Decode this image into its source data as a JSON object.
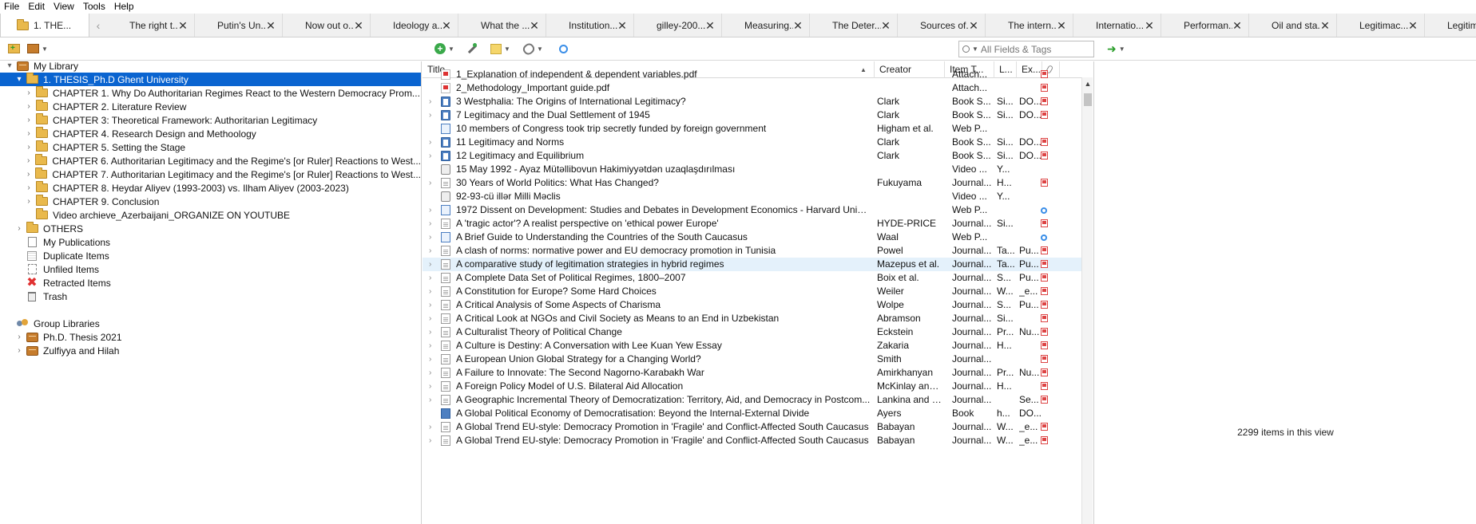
{
  "menubar": [
    "File",
    "Edit",
    "View",
    "Tools",
    "Help"
  ],
  "tabs": {
    "active": "1. THE...",
    "others": [
      "The right t...",
      "Putin's Un...",
      "Now out o...",
      "Ideology a...",
      "What the ...",
      "Institution...",
      "gilley-200...",
      "Measuring...",
      "The Deter...",
      "Sources of...",
      "The intern...",
      "Internatio...",
      "Performan...",
      "Oil and sta...",
      "Legitimac...",
      "Legitim"
    ]
  },
  "toolbar": {
    "search_placeholder": "All Fields & Tags"
  },
  "collections": [
    {
      "label": "My Library",
      "level": 0,
      "icon": "library-icon",
      "twisty": "▾"
    },
    {
      "label": "1. THESIS_Ph.D Ghent University",
      "level": 1,
      "icon": "folder-icon",
      "twisty": "▾",
      "selected": true
    },
    {
      "label": "CHAPTER 1. Why Do Authoritarian Regimes React to the Western Democracy Prom...",
      "level": 2,
      "icon": "folder-icon",
      "twisty": "›"
    },
    {
      "label": "CHAPTER 2. Literature Review",
      "level": 2,
      "icon": "folder-icon",
      "twisty": "›"
    },
    {
      "label": "CHAPTER 3: Theoretical Framework: Authoritarian Legitimacy",
      "level": 2,
      "icon": "folder-icon",
      "twisty": "›"
    },
    {
      "label": "CHAPTER 4. Research Design and Methoology",
      "level": 2,
      "icon": "folder-icon",
      "twisty": "›"
    },
    {
      "label": "CHAPTER 5. Setting the Stage",
      "level": 2,
      "icon": "folder-icon",
      "twisty": "›"
    },
    {
      "label": "CHAPTER 6. Authoritarian Legitimacy and the Regime's [or Ruler] Reactions to West...",
      "level": 2,
      "icon": "folder-icon",
      "twisty": "›"
    },
    {
      "label": "CHAPTER 7. Authoritarian Legitimacy and the Regime's [or Ruler] Reactions to West...",
      "level": 2,
      "icon": "folder-icon",
      "twisty": "›"
    },
    {
      "label": "CHAPTER 8. Heydar Aliyev (1993-2003) vs. Ilham Aliyev (2003-2023)",
      "level": 2,
      "icon": "folder-icon",
      "twisty": "›"
    },
    {
      "label": "CHAPTER 9. Conclusion",
      "level": 2,
      "icon": "folder-icon",
      "twisty": "›"
    },
    {
      "label": "Video archieve_Azerbaijani_ORGANIZE ON YOUTUBE",
      "level": 2,
      "icon": "folder-icon",
      "twisty": ""
    },
    {
      "label": "OTHERS",
      "level": 1,
      "icon": "folder-icon",
      "twisty": "›"
    },
    {
      "label": "My Publications",
      "level": 1,
      "icon": "document-icon",
      "twisty": ""
    },
    {
      "label": "Duplicate Items",
      "level": 1,
      "icon": "duplicate-icon",
      "twisty": ""
    },
    {
      "label": "Unfiled Items",
      "level": 1,
      "icon": "unfiled-icon",
      "twisty": ""
    },
    {
      "label": "Retracted Items",
      "level": 1,
      "icon": "retracted-icon",
      "twisty": ""
    },
    {
      "label": "Trash",
      "level": 1,
      "icon": "trash-icon",
      "twisty": ""
    },
    {
      "label": "",
      "level": 0,
      "icon": "",
      "twisty": ""
    },
    {
      "label": "Group Libraries",
      "level": 0,
      "icon": "group-icon",
      "twisty": ""
    },
    {
      "label": "Ph.D. Thesis 2021",
      "level": 1,
      "icon": "library-icon",
      "twisty": "›"
    },
    {
      "label": "Zulfiyya and Hilah",
      "level": 1,
      "icon": "library-icon",
      "twisty": "›"
    }
  ],
  "columns": {
    "title": "Title",
    "creator": "Creator",
    "item_type": "Item T...",
    "l": "L...",
    "ex": "Ex..."
  },
  "items": [
    {
      "title": "1_Explanation of independent & dependent variables.pdf",
      "creator": "",
      "type": "Attach...",
      "l": "",
      "ex": "",
      "icon": "pdf",
      "att": "pdf",
      "child": false
    },
    {
      "title": "2_Methodology_Important guide.pdf",
      "creator": "",
      "type": "Attach...",
      "l": "",
      "ex": "",
      "icon": "pdf",
      "att": "pdf",
      "child": false
    },
    {
      "title": "3 Westphalia: The Origins of International Legitimacy?",
      "creator": "Clark",
      "type": "Book S...",
      "l": "Si...",
      "ex": "DO...",
      "icon": "book",
      "att": "pdf",
      "child": true
    },
    {
      "title": "7 Legitimacy and the Dual Settlement of 1945",
      "creator": "Clark",
      "type": "Book S...",
      "l": "Si...",
      "ex": "DO...",
      "icon": "book",
      "att": "pdf",
      "child": true
    },
    {
      "title": "10 members of Congress took trip secretly funded by foreign government",
      "creator": "Higham et al.",
      "type": "Web P...",
      "l": "",
      "ex": "",
      "icon": "web",
      "att": "",
      "child": false
    },
    {
      "title": "11 Legitimacy and Norms",
      "creator": "Clark",
      "type": "Book S...",
      "l": "Si...",
      "ex": "DO...",
      "icon": "book",
      "att": "pdf",
      "child": true
    },
    {
      "title": "12 Legitimacy and Equilibrium",
      "creator": "Clark",
      "type": "Book S...",
      "l": "Si...",
      "ex": "DO...",
      "icon": "book",
      "att": "pdf",
      "child": true
    },
    {
      "title": "15 May 1992 - Ayaz Mütəllibovun Hakimiyyətdən uzaqlaşdırılması",
      "creator": "",
      "type": "Video ...",
      "l": "Y...",
      "ex": "",
      "icon": "video",
      "att": "",
      "child": false
    },
    {
      "title": "30 Years of World Politics: What Has Changed?",
      "creator": "Fukuyama",
      "type": "Journal...",
      "l": "H...",
      "ex": "",
      "icon": "article",
      "att": "pdf",
      "child": true
    },
    {
      "title": "92-93-cü illər Milli Məclis",
      "creator": "",
      "type": "Video ...",
      "l": "Y...",
      "ex": "",
      "icon": "video",
      "att": "",
      "child": false
    },
    {
      "title": "1972 Dissent on Development: Studies and Debates in Development Economics - Harvard Univer...",
      "creator": "",
      "type": "Web P...",
      "l": "",
      "ex": "",
      "icon": "web",
      "att": "web",
      "child": true
    },
    {
      "title": "A 'tragic actor'? A realist perspective on 'ethical power Europe'",
      "creator": "HYDE-PRICE",
      "type": "Journal...",
      "l": "Si...",
      "ex": "",
      "icon": "article",
      "att": "pdf",
      "child": true
    },
    {
      "title": "A Brief Guide to Understanding the Countries of the South Caucasus",
      "creator": "Waal",
      "type": "Web P...",
      "l": "",
      "ex": "",
      "icon": "web",
      "att": "web",
      "child": true
    },
    {
      "title": "A clash of norms: normative power and EU democracy promotion in Tunisia",
      "creator": "Powel",
      "type": "Journal...",
      "l": "Ta...",
      "ex": "Pu...",
      "icon": "article",
      "att": "pdf",
      "child": true
    },
    {
      "title": "A comparative study of legitimation strategies in hybrid regimes",
      "creator": "Mazepus et al.",
      "type": "Journal...",
      "l": "Ta...",
      "ex": "Pu...",
      "icon": "article",
      "att": "pdf",
      "child": true,
      "highlight": true
    },
    {
      "title": "A Complete Data Set of Political Regimes, 1800–2007",
      "creator": "Boix et al.",
      "type": "Journal...",
      "l": "S...",
      "ex": "Pu...",
      "icon": "article",
      "att": "pdf",
      "child": true
    },
    {
      "title": "A Constitution for Europe? Some Hard Choices",
      "creator": "Weiler",
      "type": "Journal...",
      "l": "W...",
      "ex": "_e...",
      "icon": "article",
      "att": "pdf",
      "child": true
    },
    {
      "title": "A Critical Analysis of Some Aspects of Charisma",
      "creator": "Wolpe",
      "type": "Journal...",
      "l": "S...",
      "ex": "Pu...",
      "icon": "article",
      "att": "pdf",
      "child": true
    },
    {
      "title": "A Critical Look at NGOs and Civil Society as Means to an End in Uzbekistan",
      "creator": "Abramson",
      "type": "Journal...",
      "l": "Si...",
      "ex": "",
      "icon": "article",
      "att": "pdf",
      "child": true
    },
    {
      "title": "A Culturalist Theory of Political Change",
      "creator": "Eckstein",
      "type": "Journal...",
      "l": "Pr...",
      "ex": "Nu...",
      "icon": "article",
      "att": "pdf",
      "child": true
    },
    {
      "title": "A Culture is Destiny: A Conversation with Lee Kuan Yew Essay",
      "creator": "Zakaria",
      "type": "Journal...",
      "l": "H...",
      "ex": "",
      "icon": "article",
      "att": "pdf",
      "child": true
    },
    {
      "title": "A European Union Global Strategy for a Changing World?",
      "creator": "Smith",
      "type": "Journal...",
      "l": "",
      "ex": "",
      "icon": "article",
      "att": "pdf",
      "child": true
    },
    {
      "title": "A Failure to Innovate: The Second Nagorno-Karabakh War",
      "creator": "Amirkhanyan",
      "type": "Journal...",
      "l": "Pr...",
      "ex": "Nu...",
      "icon": "article",
      "att": "pdf",
      "child": true
    },
    {
      "title": "A Foreign Policy Model of U.S. Bilateral Aid Allocation",
      "creator": "McKinlay and L...",
      "type": "Journal...",
      "l": "H...",
      "ex": "",
      "icon": "article",
      "att": "pdf",
      "child": true
    },
    {
      "title": "A Geographic Incremental Theory of Democratization: Territory, Aid, and Democracy in Postcom...",
      "creator": "Lankina and Ge...",
      "type": "Journal...",
      "l": "",
      "ex": "Se...",
      "icon": "article",
      "att": "pdf",
      "child": true
    },
    {
      "title": "A Global Political Economy of Democratisation: Beyond the Internal-External Divide",
      "creator": "Ayers",
      "type": "Book",
      "l": "h...",
      "ex": "DO...",
      "icon": "bookplain",
      "att": "",
      "child": false
    },
    {
      "title": "A Global Trend EU-style: Democracy Promotion in 'Fragile' and Conflict-Affected South Caucasus",
      "creator": "Babayan",
      "type": "Journal...",
      "l": "W...",
      "ex": "_e...",
      "icon": "article",
      "att": "pdf",
      "child": true
    },
    {
      "title": "A Global Trend EU-style: Democracy Promotion in 'Fragile' and Conflict-Affected South Caucasus",
      "creator": "Babayan",
      "type": "Journal...",
      "l": "W...",
      "ex": "_e...",
      "icon": "article",
      "att": "pdf",
      "child": true
    }
  ],
  "status": {
    "item_count": "2299 items in this view"
  },
  "colors": {
    "selection": "#0a64d0",
    "row_highlight": "#e4f1fb",
    "folder": "#e9b94c"
  }
}
